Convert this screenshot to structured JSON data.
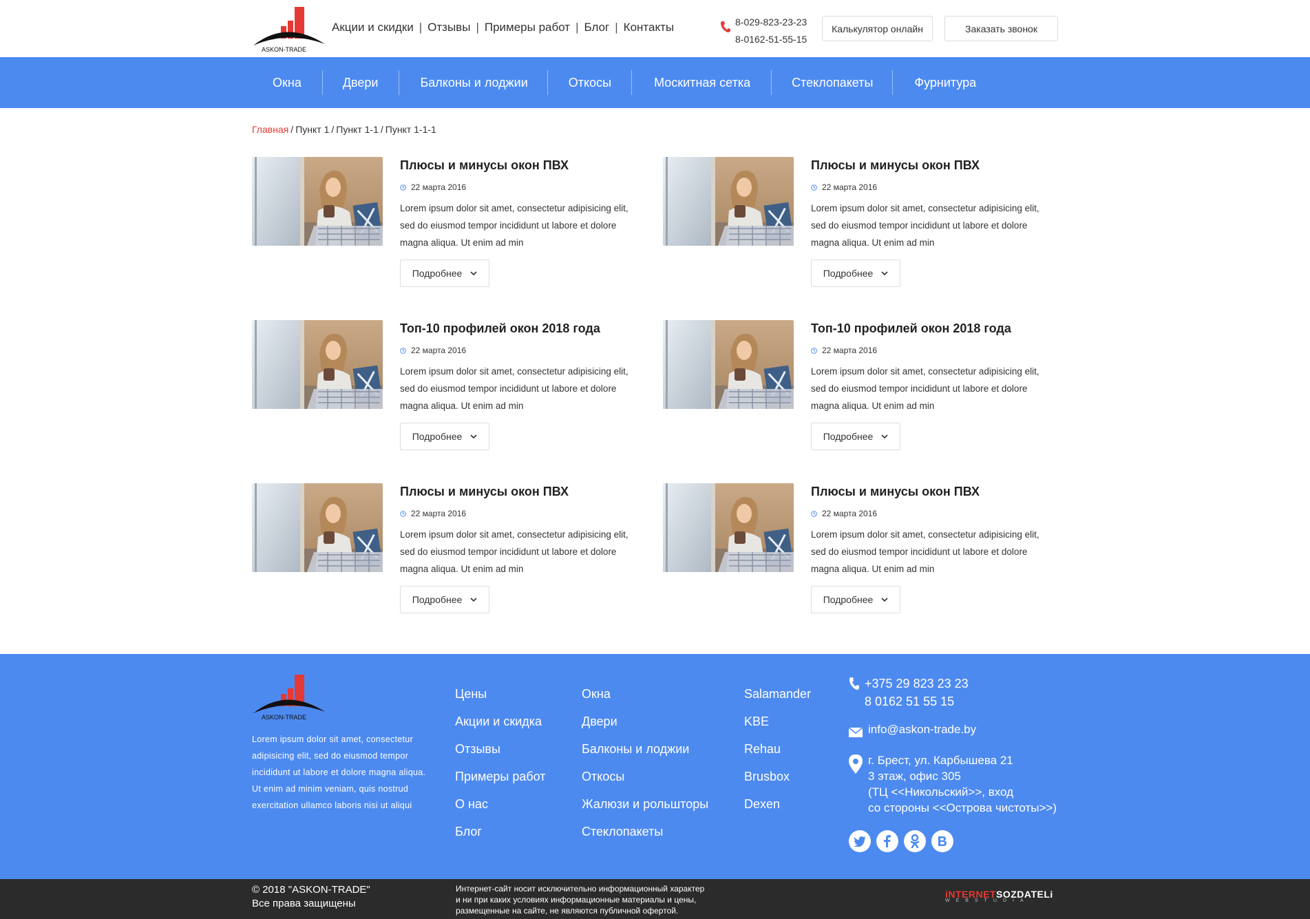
{
  "header": {
    "logo_text": "ASKON-TRADE",
    "top_nav": [
      "Акции и скидки",
      "Отзывы",
      "Примеры работ",
      "Блог",
      "Контакты"
    ],
    "phones": [
      "8-029-823-23-23",
      "8-0162-51-55-15"
    ],
    "calc_button": "Калькулятор онлайн",
    "call_button": "Заказать звонок"
  },
  "main_nav": [
    "Окна",
    "Двери",
    "Балконы и лоджии",
    "Откосы",
    "Москитная сетка",
    "Стеклопакеты",
    "Фурнитура"
  ],
  "breadcrumb": {
    "home": "Главная",
    "items": [
      "Пункт 1",
      "Пункт 1-1",
      "Пункт 1-1-1"
    ]
  },
  "articles": [
    {
      "title": "Плюсы и минусы окон ПВХ",
      "date": "22 марта 2016",
      "text": "Lorem ipsum dolor sit amet, consectetur adipisicing elit, sed do eiusmod tempor incididunt ut labore et dolore magna aliqua. Ut enim ad min",
      "more": "Подробнее"
    },
    {
      "title": "Плюсы и минусы окон ПВХ",
      "date": "22 марта 2016",
      "text": "Lorem ipsum dolor sit amet, consectetur adipisicing elit, sed do eiusmod tempor incididunt ut labore et dolore magna aliqua. Ut enim ad min",
      "more": "Подробнее"
    },
    {
      "title": "Топ-10 профилей окон 2018 года",
      "date": "22 марта 2016",
      "text": "Lorem ipsum dolor sit amet, consectetur adipisicing elit, sed do eiusmod tempor incididunt ut labore et dolore magna aliqua. Ut enim ad min",
      "more": "Подробнее"
    },
    {
      "title": "Топ-10 профилей окон 2018 года",
      "date": "22 марта 2016",
      "text": "Lorem ipsum dolor sit amet, consectetur adipisicing elit, sed do eiusmod tempor incididunt ut labore et dolore magna aliqua. Ut enim ad min",
      "more": "Подробнее"
    },
    {
      "title": "Плюсы и минусы окон ПВХ",
      "date": "22 марта 2016",
      "text": "Lorem ipsum dolor sit amet, consectetur adipisicing elit, sed do eiusmod tempor incididunt ut labore et dolore magna aliqua. Ut enim ad min",
      "more": "Подробнее"
    },
    {
      "title": "Плюсы и минусы окон ПВХ",
      "date": "22 марта 2016",
      "text": "Lorem ipsum dolor sit amet, consectetur adipisicing elit, sed do eiusmod tempor incididunt ut labore et dolore magna aliqua. Ut enim ad min",
      "more": "Подробнее"
    }
  ],
  "footer": {
    "logo_text": "ASKON-TRADE",
    "description": "Lorem ipsum dolor sit amet, consectetur adipisicing elit, sed do eiusmod tempor incididunt ut labore et dolore magna aliqua. Ut enim ad minim veniam, quis nostrud exercitation ullamco laboris nisi ut aliqui",
    "col1": [
      "Цены",
      "Акции и скидка",
      "Отзывы",
      "Примеры работ",
      "О нас",
      "Блог"
    ],
    "col2": [
      "Окна",
      "Двери",
      "Балконы и лоджии",
      "Откосы",
      "Жалюзи и рольшторы",
      "Стеклопакеты"
    ],
    "col3": [
      "Salamander",
      "KBE",
      "Rehau",
      "Brusbox",
      "Dexen"
    ],
    "phones": [
      "+375 29 823 23 23",
      "8 0162 51 55 15"
    ],
    "email": "info@askon-trade.by",
    "address": [
      "г. Брест, ул. Карбышева 21",
      "3 этаж, офис 305",
      "(ТЦ <<Никольский>>, вход",
      "со стороны <<Острова чистоты>>)"
    ],
    "socials": [
      "twitter-icon",
      "facebook-icon",
      "odnoklassniki-icon",
      "vk-icon"
    ]
  },
  "bottom": {
    "copyright": "© 2018 \"ASKON-TRADE\"",
    "rights": "Все права защищены",
    "disclaimer": [
      "Интернет-сайт носит исключительно информационный характер",
      "и ни при каких условиях информационные материалы и цены,",
      "размещенные на сайте, не являются публичной офертой."
    ],
    "developer_red": "iNTERNET",
    "developer_white": "SOZDATELi",
    "developer_sub": "WEBSTUDIA"
  },
  "colors": {
    "brand_blue": "#4d8af0",
    "accent_red": "#e53935",
    "dark_bar": "#2b2b2b"
  }
}
